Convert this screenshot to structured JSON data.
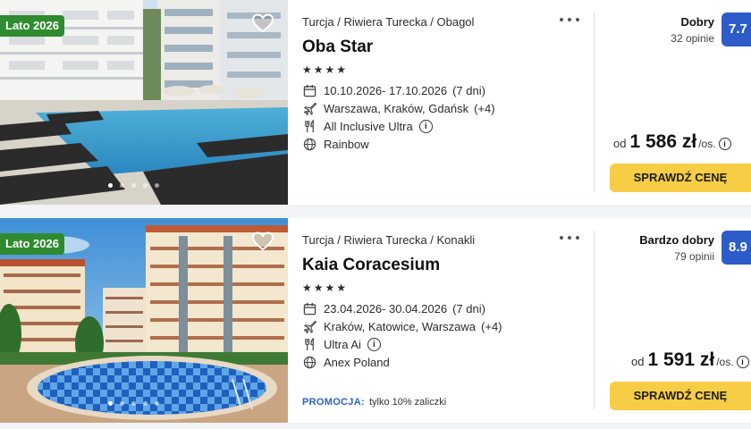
{
  "results": [
    {
      "badge": "Lato 2026",
      "breadcrumb": "Turcja / Riwiera Turecka / Obagol",
      "name": "Oba Star",
      "stars": "★★★★",
      "star_count": 4,
      "dates": "10.10.2026- 17.10.2026",
      "duration": "(7 dni)",
      "departures": "Warszawa, Kraków, Gdańsk",
      "departures_more": "(+4)",
      "board": "All Inclusive Ultra",
      "operator": "Rainbow",
      "rating_label": "Dobry",
      "reviews": "32 opinie",
      "score": "7.7",
      "price_prefix": "od",
      "price": "1 586 zł",
      "price_suffix": "/os.",
      "button": "SPRAWDŹ CENĘ",
      "promo_label": "",
      "promo_text": ""
    },
    {
      "badge": "Lato 2026",
      "breadcrumb": "Turcja / Riwiera Turecka / Konakli",
      "name": "Kaia Coracesium",
      "stars": "★★★★",
      "star_count": 4,
      "dates": "23.04.2026- 30.04.2026",
      "duration": "(7 dni)",
      "departures": "Kraków, Katowice, Warszawa",
      "departures_more": "(+4)",
      "board": "Ultra Ai",
      "operator": "Anex Poland",
      "rating_label": "Bardzo dobry",
      "reviews": "79 opinii",
      "score": "8.9",
      "price_prefix": "od",
      "price": "1 591 zł",
      "price_suffix": "/os.",
      "button": "SPRAWDŹ CENĘ",
      "promo_label": "PROMOCJA:",
      "promo_text": "tylko 10% zaliczki"
    }
  ],
  "colors": {
    "badge": "#2f8b2f",
    "score": "#2d5cc8",
    "button": "#f7cd45",
    "promo": "#2a62c7"
  },
  "icons": [
    "heart-icon",
    "more-dots-icon",
    "calendar-icon",
    "plane-icon",
    "cutlery-icon",
    "info-icon",
    "globe-icon",
    "star-icon"
  ]
}
